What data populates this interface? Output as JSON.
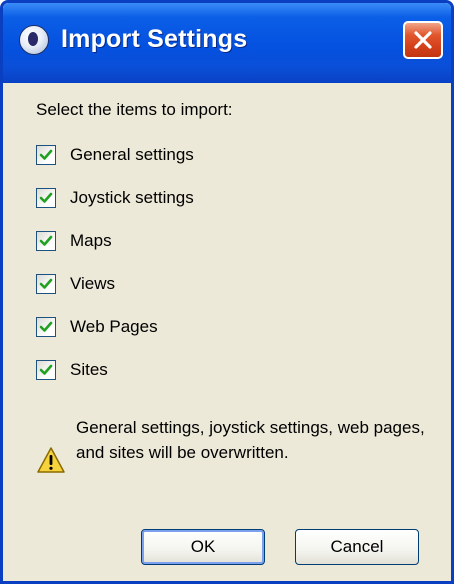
{
  "window": {
    "title": "Import Settings"
  },
  "prompt": "Select the items to import:",
  "items": [
    {
      "label": "General settings",
      "checked": true
    },
    {
      "label": "Joystick settings",
      "checked": true
    },
    {
      "label": "Maps",
      "checked": true
    },
    {
      "label": "Views",
      "checked": true
    },
    {
      "label": "Web Pages",
      "checked": true
    },
    {
      "label": "Sites",
      "checked": true
    }
  ],
  "warning": {
    "icon": "warning-icon",
    "text": "General settings, joystick settings, web pages, and sites will be overwritten."
  },
  "buttons": {
    "ok": "OK",
    "cancel": "Cancel"
  },
  "colors": {
    "titlebar": "#0551e0",
    "dialog_bg": "#ece9d8",
    "check_mark": "#21a121",
    "close_button": "#d3401c"
  }
}
